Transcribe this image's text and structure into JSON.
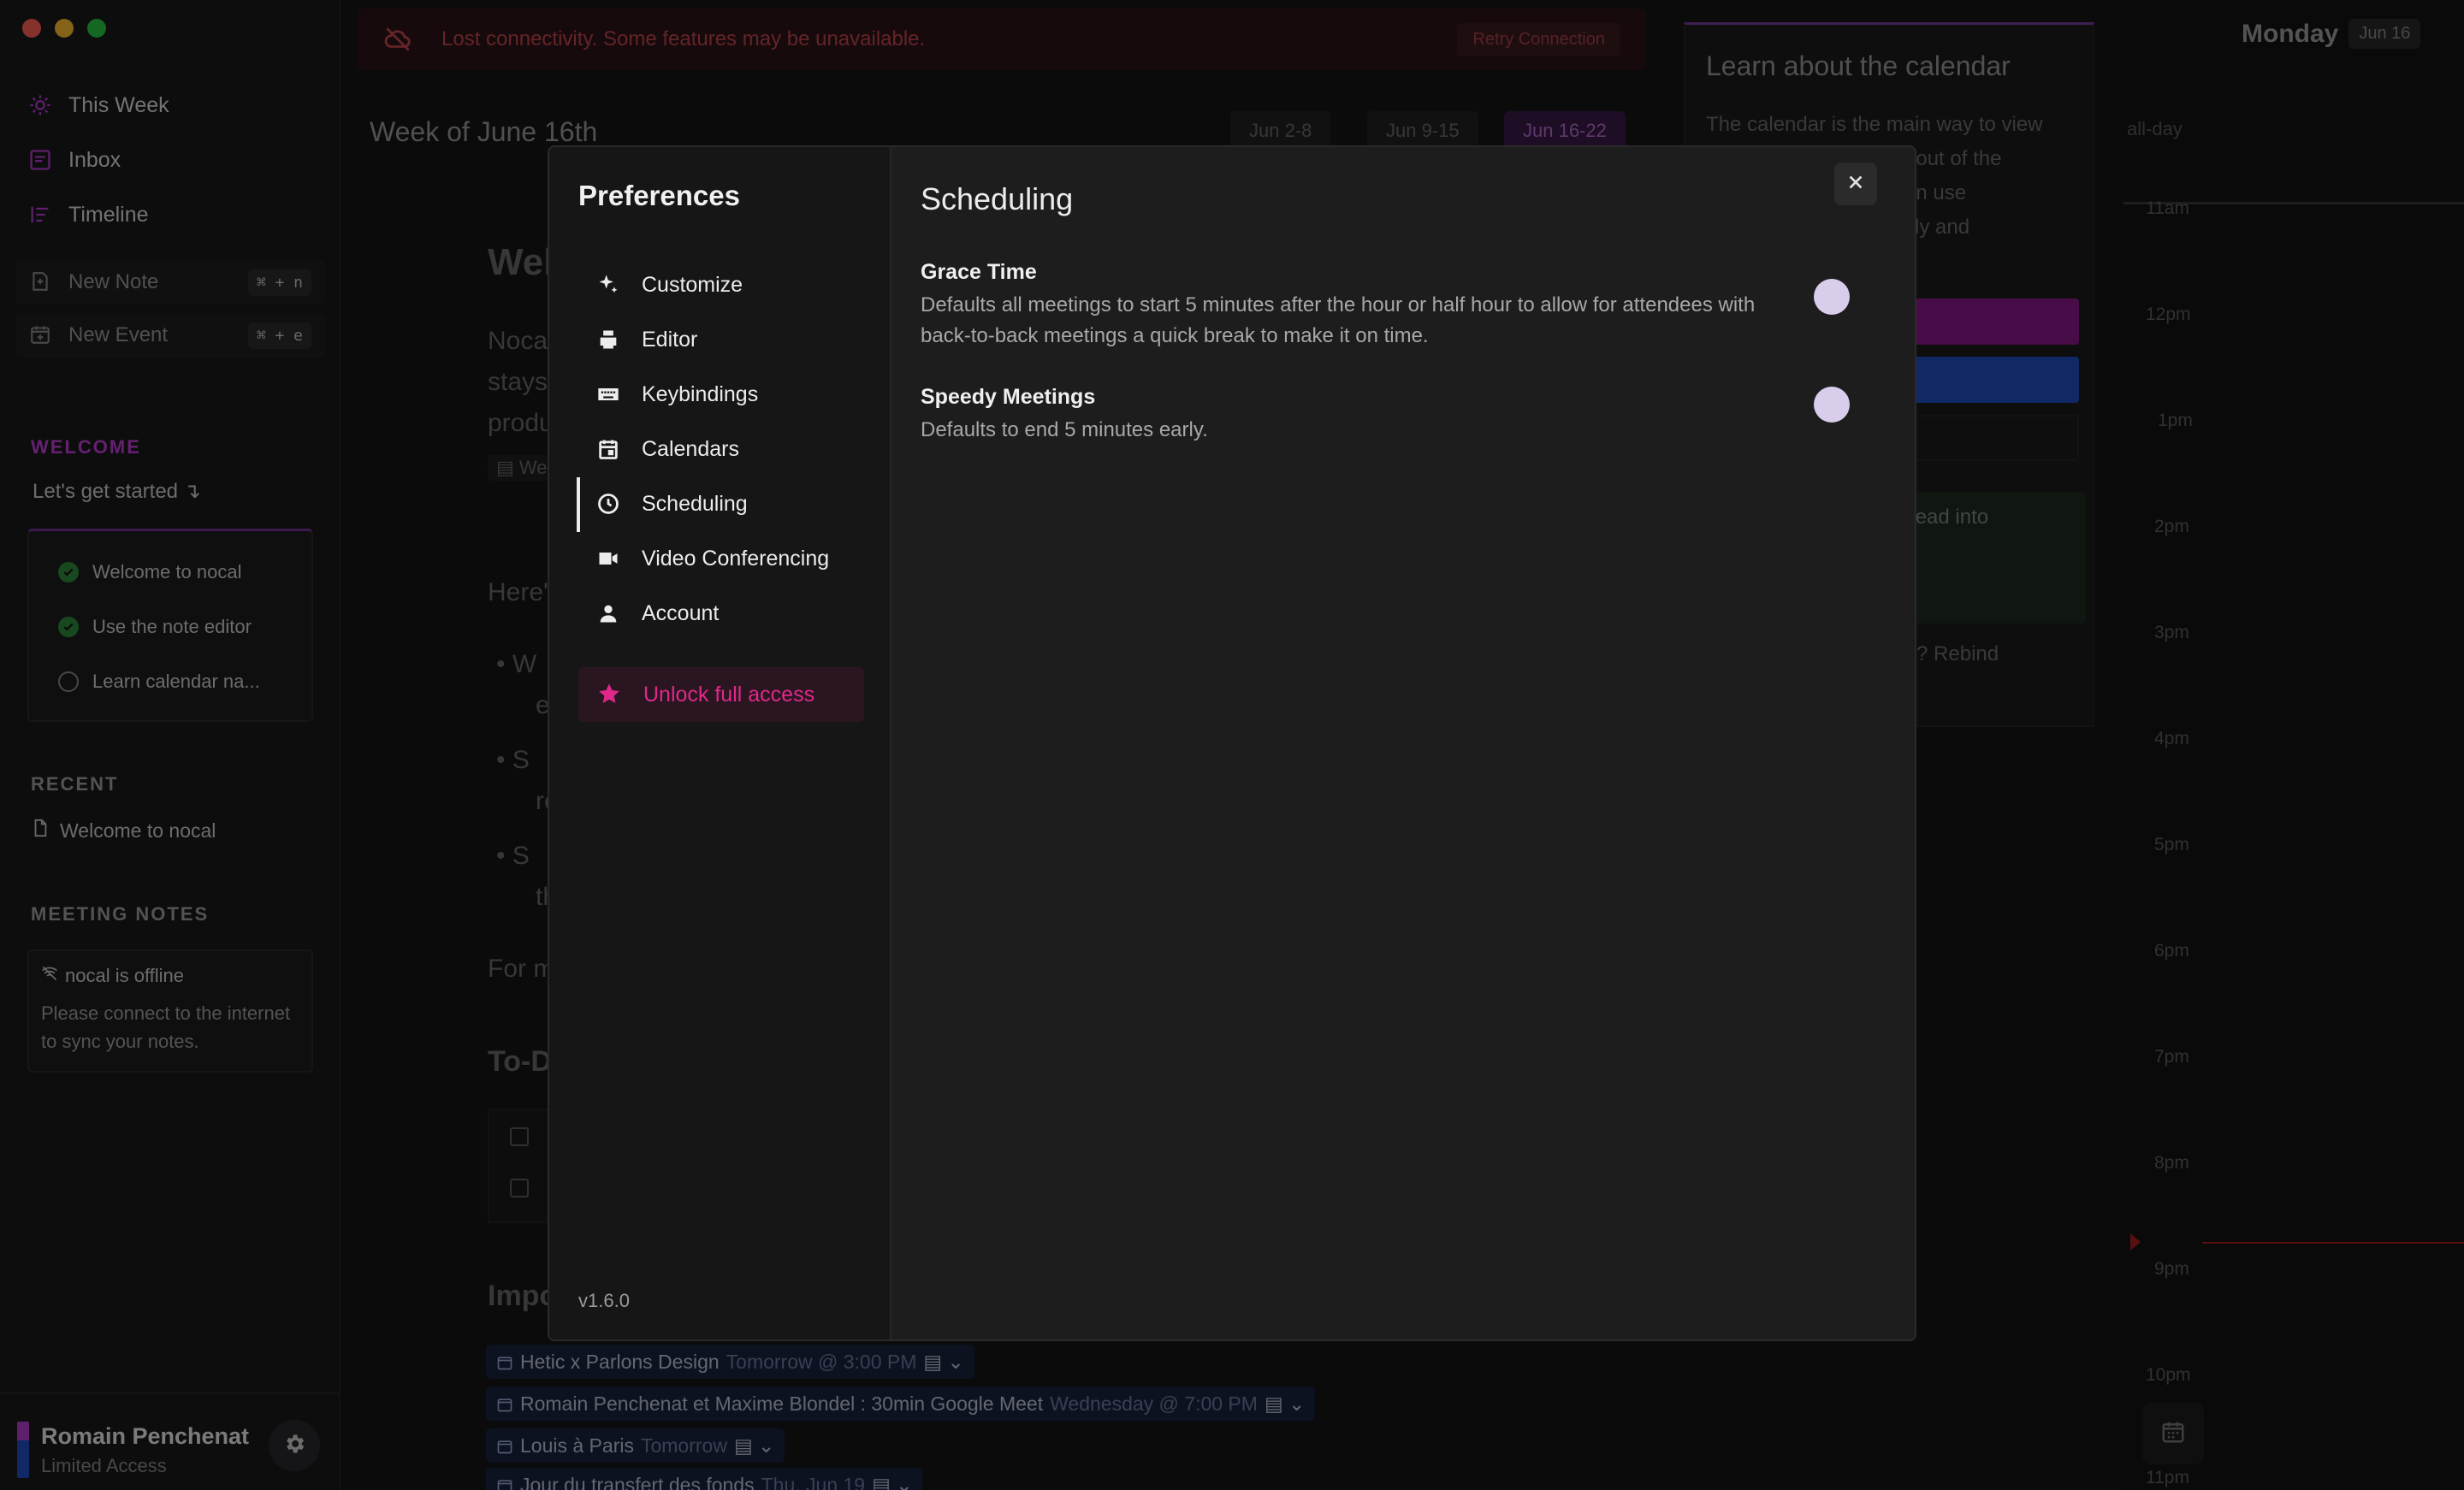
{
  "sidebar": {
    "nav": [
      {
        "label": "This Week",
        "icon": "sun-icon"
      },
      {
        "label": "Inbox",
        "icon": "inbox-icon"
      },
      {
        "label": "Timeline",
        "icon": "timeline-icon"
      }
    ],
    "new_note": {
      "label": "New Note",
      "shortcut": "⌘ + n"
    },
    "new_event": {
      "label": "New Event",
      "shortcut": "⌘ + e"
    },
    "welcome": {
      "title": "WELCOME",
      "subtitle": "Let's get started ↴",
      "items": [
        {
          "label": "Welcome to nocal",
          "done": true
        },
        {
          "label": "Use the note editor",
          "done": true
        },
        {
          "label": "Learn calendar na...",
          "done": false
        }
      ]
    },
    "recent": {
      "title": "RECENT",
      "items": [
        "Welcome to nocal"
      ]
    },
    "meeting_notes": {
      "title": "MEETING NOTES",
      "offline_title": "nocal is offline",
      "offline_body": "Please connect to the internet to sync your notes."
    },
    "user": {
      "name": "Romain Penchenat",
      "status": "Limited Access"
    }
  },
  "banner": {
    "message": "Lost connectivity. Some features may be unavailable.",
    "retry": "Retry Connection"
  },
  "main": {
    "week_title": "Week of June 16th",
    "week_tabs": [
      "Jun 2-8",
      "Jun 9-15",
      "Jun 16-22"
    ],
    "active_tab": "Jun 16-22",
    "fragments": {
      "heading": "Wel",
      "p1": "Noca",
      "p2": "stays",
      "p3": "produ",
      "link": "We",
      "p4": "Here'",
      "b1a": "W",
      "b1b": "e",
      "b2a": "S",
      "b2b": "re",
      "b3a": "S",
      "b3b": "th",
      "p5": "For m",
      "todo": "To-D",
      "imp": "Impo"
    },
    "events": [
      {
        "title": "Hetic x Parlons Design",
        "when": "Tomorrow @ 3:00 PM"
      },
      {
        "title": "Romain Penchenat et Maxime Blondel : 30min Google Meet",
        "when": "Wednesday @ 7:00 PM"
      },
      {
        "title": "Louis à Paris",
        "when": "Tomorrow"
      },
      {
        "title": "Jour du transfert des fonds",
        "when": "Thu, Jun 19"
      }
    ]
  },
  "learn_panel": {
    "title": "Learn about the calendar",
    "body_lines": [
      "The calendar is the main way to view",
      "ked out of the",
      "u can use",
      "easily and"
    ],
    "ahead": "ahead into",
    "rebind": "oard? Rebind",
    "arrow": "›"
  },
  "day_view": {
    "day": "Monday",
    "date": "Jun 16",
    "allday": "all-day",
    "hours": [
      "11am",
      "12pm",
      "1pm",
      "2pm",
      "3pm",
      "4pm",
      "5pm",
      "6pm",
      "7pm",
      "8pm",
      "9pm",
      "10pm",
      "11pm"
    ]
  },
  "preferences": {
    "title": "Preferences",
    "nav": [
      {
        "label": "Customize",
        "icon": "sparkles-icon"
      },
      {
        "label": "Editor",
        "icon": "editor-icon"
      },
      {
        "label": "Keybindings",
        "icon": "keyboard-icon"
      },
      {
        "label": "Calendars",
        "icon": "calendar-icon"
      },
      {
        "label": "Scheduling",
        "icon": "clock-icon"
      },
      {
        "label": "Video Conferencing",
        "icon": "video-icon"
      },
      {
        "label": "Account",
        "icon": "person-icon"
      }
    ],
    "active": "Scheduling",
    "unlock": "Unlock full access",
    "version": "v1.6.0",
    "section_title": "Scheduling",
    "settings": [
      {
        "title": "Grace Time",
        "description": "Defaults all meetings to start 5 minutes after the hour or half hour to allow for attendees with back-to-back meetings a quick break to make it on time.",
        "enabled": false
      },
      {
        "title": "Speedy Meetings",
        "description": "Defaults to end 5 minutes early.",
        "enabled": false
      }
    ]
  },
  "colors": {
    "accent": "#b43ccf",
    "danger": "#c0454d",
    "unlock": "#e0288a"
  }
}
